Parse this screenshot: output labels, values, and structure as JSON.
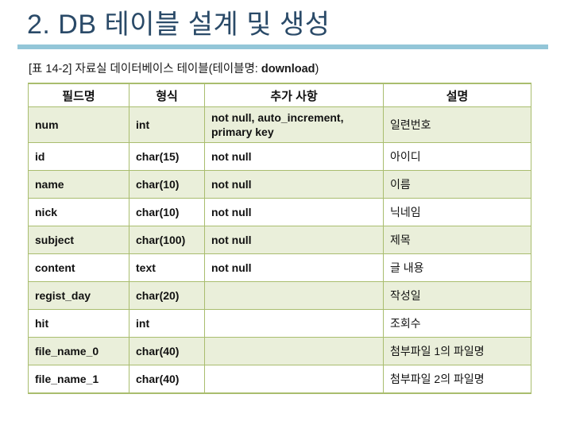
{
  "slide": {
    "title": "2. DB 테이블 설계 및 생성",
    "rule_color": "#93c6d8",
    "title_color": "#2a4a68"
  },
  "table": {
    "caption_prefix": "[표 14-2] 자료실 데이터베이스 테이블(테이블명: ",
    "caption_bold": "download",
    "caption_suffix": ")",
    "border_color": "#a9bd6e",
    "shade_color": "#eaefda",
    "headers": [
      "필드명",
      "형식",
      "추가 사항",
      "설명"
    ],
    "rows": [
      {
        "field": "num",
        "type": "int",
        "extra": "not null, auto_increment, primary key",
        "desc": "일련번호",
        "shaded": true,
        "tall": true
      },
      {
        "field": "id",
        "type": "char(15)",
        "extra": "not null",
        "desc": "아이디",
        "shaded": false,
        "tall": false
      },
      {
        "field": "name",
        "type": "char(10)",
        "extra": "not null",
        "desc": "이름",
        "shaded": true,
        "tall": false
      },
      {
        "field": "nick",
        "type": "char(10)",
        "extra": "not null",
        "desc": "닉네임",
        "shaded": false,
        "tall": false
      },
      {
        "field": "subject",
        "type": "char(100)",
        "extra": "not null",
        "desc": "제목",
        "shaded": true,
        "tall": false
      },
      {
        "field": "content",
        "type": "text",
        "extra": "not null",
        "desc": "글 내용",
        "shaded": false,
        "tall": false
      },
      {
        "field": "regist_day",
        "type": "char(20)",
        "extra": "",
        "desc": "작성일",
        "shaded": true,
        "tall": false
      },
      {
        "field": "hit",
        "type": "int",
        "extra": "",
        "desc": "조회수",
        "shaded": false,
        "tall": false
      },
      {
        "field": "file_name_0",
        "type": "char(40)",
        "extra": "",
        "desc": "첨부파일 1의 파일명",
        "shaded": true,
        "tall": false
      },
      {
        "field": "file_name_1",
        "type": "char(40)",
        "extra": "",
        "desc": "첨부파일 2의 파일명",
        "shaded": false,
        "tall": false
      }
    ]
  }
}
